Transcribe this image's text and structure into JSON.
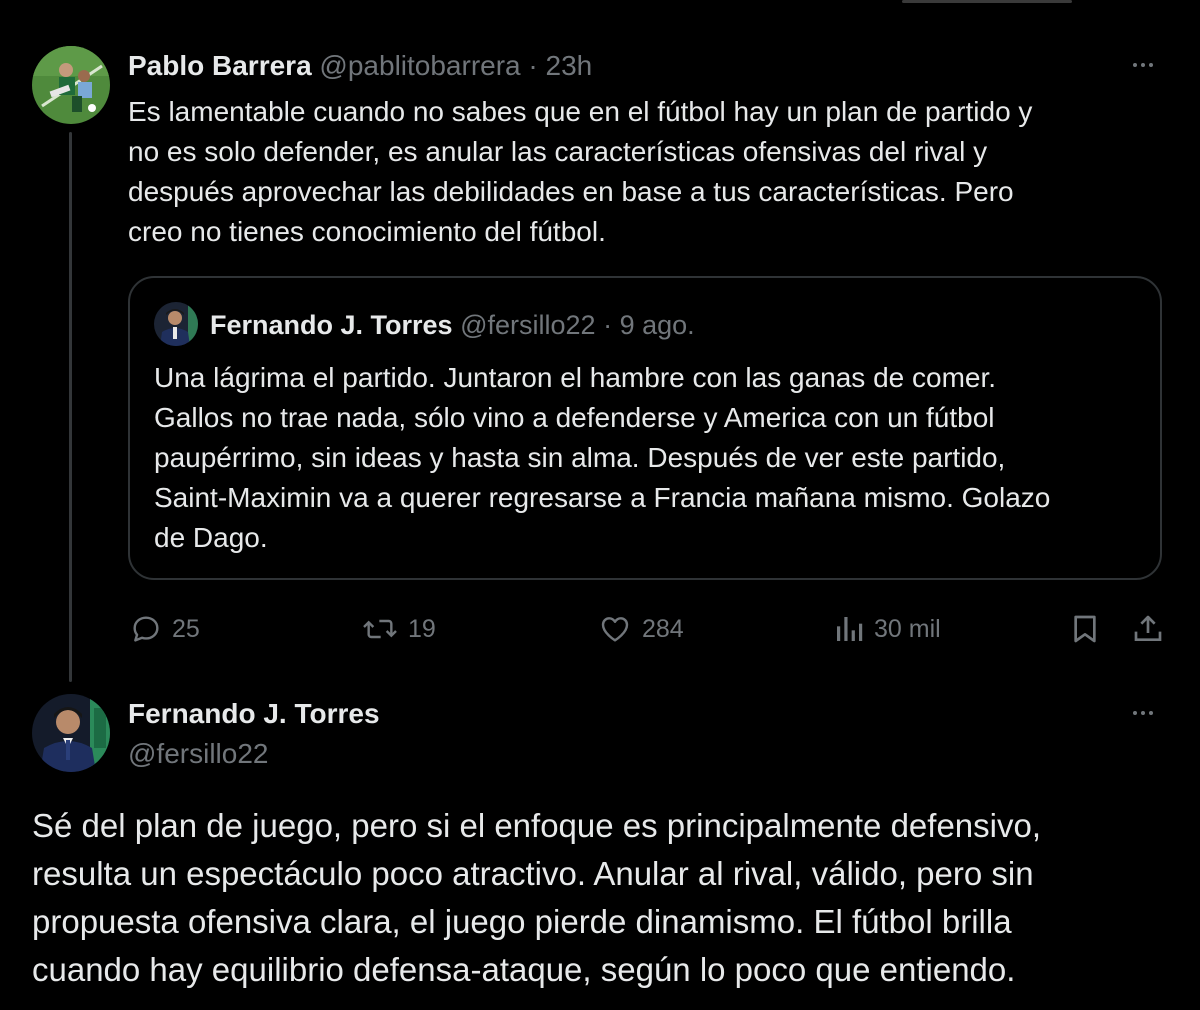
{
  "reply": {
    "author_name": "Pablo Barrera",
    "author_handle": "@pablitobarrera",
    "separator": "·",
    "time": "23h",
    "text_lines": [
      "Es lamentable cuando no sabes que en el fútbol hay un plan  de partido y",
      "no es solo defender, es anular las características ofensivas del rival y",
      "después aprovechar las debilidades  en base a tus características. Pero",
      "creo no tienes conocimiento del fútbol."
    ],
    "more_icon": "more-horizontal-icon"
  },
  "quote": {
    "author_name": "Fernando J. Torres",
    "author_handle": "@fersillo22",
    "separator": "·",
    "time": "9 ago.",
    "text_lines": [
      "Una lágrima el partido. Juntaron el hambre con las ganas de comer.",
      "Gallos no trae nada, sólo vino a defenderse y America con un fútbol",
      "paupérrimo, sin ideas y hasta sin alma. Después de ver este partido,",
      "Saint-Maximin va a querer regresarse a Francia mañana mismo. Golazo",
      "de Dago."
    ]
  },
  "actions": {
    "replies": "25",
    "reposts": "19",
    "likes": "284",
    "views": "30 mil",
    "icons": [
      "reply-icon",
      "repost-icon",
      "like-icon",
      "views-icon",
      "bookmark-icon",
      "share-icon"
    ]
  },
  "main": {
    "author_name": "Fernando J. Torres",
    "author_handle": "@fersillo22",
    "text_lines": [
      "Sé del plan de juego, pero si el enfoque es principalmente defensivo,",
      "resulta un espectáculo poco atractivo. Anular al rival, válido, pero sin",
      "propuesta ofensiva clara, el juego pierde dinamismo. El fútbol brilla",
      "cuando hay equilibrio defensa-ataque, según lo poco que entiendo."
    ],
    "more_icon": "more-horizontal-icon"
  },
  "colors": {
    "background": "#000000",
    "text": "#e7e9ea",
    "muted": "#71767b",
    "border": "#2f3336"
  }
}
